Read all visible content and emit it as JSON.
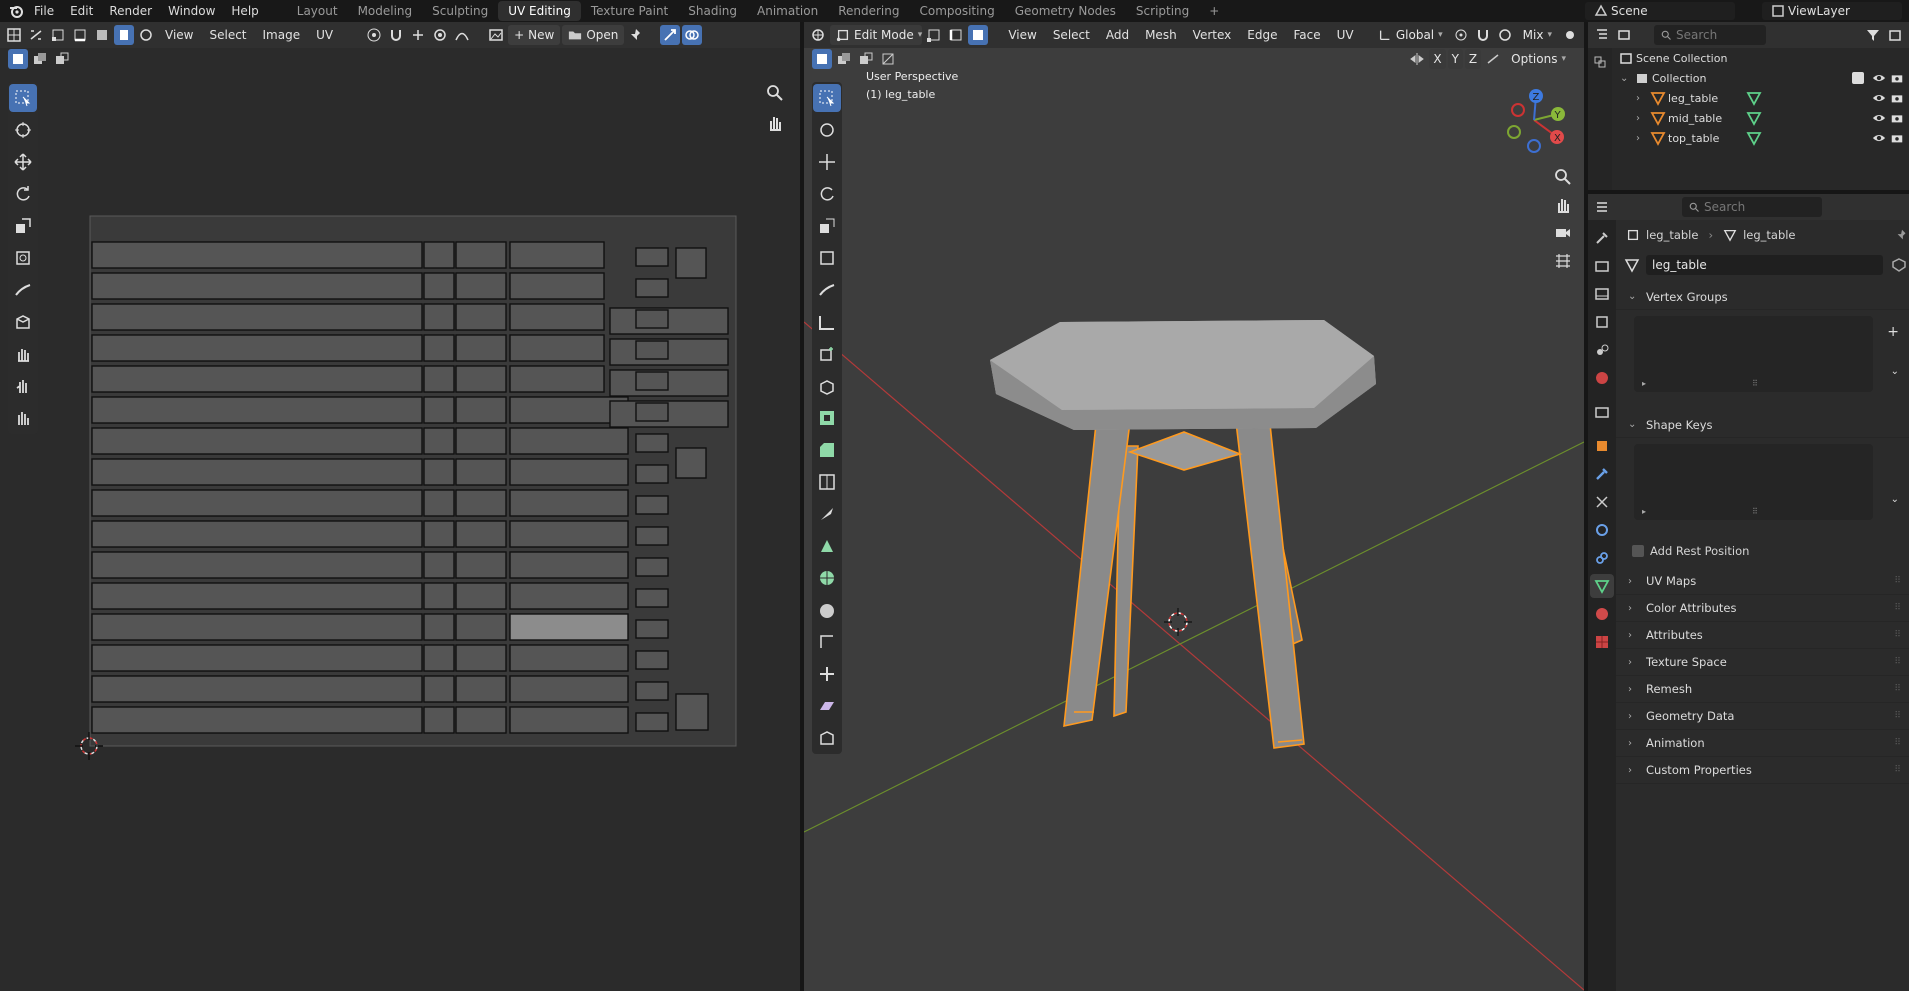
{
  "topbar": {
    "menus": [
      "File",
      "Edit",
      "Render",
      "Window",
      "Help"
    ],
    "workspaces": [
      "Layout",
      "Modeling",
      "Sculpting",
      "UV Editing",
      "Texture Paint",
      "Shading",
      "Animation",
      "Rendering",
      "Compositing",
      "Geometry Nodes",
      "Scripting"
    ],
    "active_workspace": "UV Editing",
    "add_tab": "+",
    "scene": "Scene",
    "view_layer": "ViewLayer"
  },
  "uv_editor": {
    "menus": [
      "View",
      "Select",
      "Image",
      "UV"
    ],
    "new_label": "New",
    "open_label": "Open"
  },
  "viewport": {
    "mode": "Edit Mode",
    "menus": [
      "View",
      "Select",
      "Add",
      "Mesh",
      "Vertex",
      "Edge",
      "Face",
      "UV"
    ],
    "orientation": "Global",
    "proportional_mode": "Mix",
    "axes": [
      "X",
      "Y",
      "Z"
    ],
    "options_label": "Options",
    "overlay_title": "User Perspective",
    "overlay_object": "(1) leg_table",
    "gizmo_axes": {
      "x": "X",
      "y": "Y",
      "z": "Z"
    },
    "colors": {
      "selected_edge": "#ff9a1f",
      "x_axis": "#c43a3a",
      "y_axis": "#6a8f2a",
      "object": "#8e8e8e"
    }
  },
  "outliner": {
    "search_placeholder": "Search",
    "scene_collection": "Scene Collection",
    "collection": "Collection",
    "objects": [
      "leg_table",
      "mid_table",
      "top_table"
    ]
  },
  "properties": {
    "search_placeholder": "Search",
    "breadcrumb_object": "leg_table",
    "breadcrumb_mesh": "leg_table",
    "mesh_name": "leg_table",
    "vertex_groups": "Vertex Groups",
    "shape_keys": "Shape Keys",
    "add_rest_position": "Add Rest Position",
    "collapsed_panels": [
      "UV Maps",
      "Color Attributes",
      "Attributes",
      "Texture Space",
      "Remesh",
      "Geometry Data",
      "Animation",
      "Custom Properties"
    ]
  }
}
